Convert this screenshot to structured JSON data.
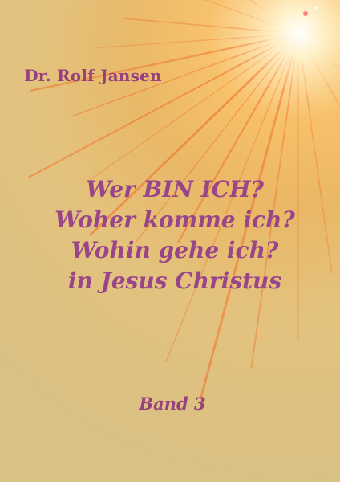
{
  "cover": {
    "author": "Dr. Rolf Jansen",
    "title_lines": [
      "Wer BIN ICH?",
      "Woher komme ich?",
      "Wohin gehe ich?",
      "in Jesus Christus"
    ],
    "volume": "Band 3"
  },
  "colors": {
    "text": "#96407e",
    "background": "#e6c27c",
    "ray": "#f0702a",
    "glow": "#fff6d8"
  }
}
